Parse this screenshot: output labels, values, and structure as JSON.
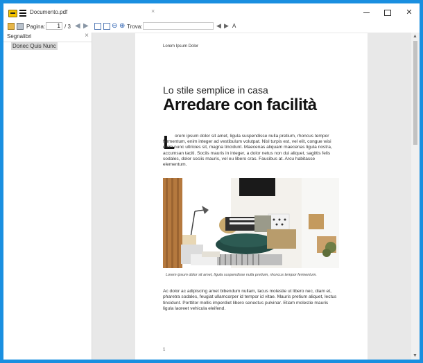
{
  "window": {
    "title": "Documento.pdf",
    "tab_close": "×",
    "minimize": "",
    "maximize": "",
    "close": "✕"
  },
  "toolbar": {
    "page_label": "Pagina:",
    "page_current": "1",
    "page_total": "/ 3",
    "find_label": "Trova:",
    "find_value": "",
    "case_icon": "A"
  },
  "bookmarks": {
    "title": "Segnalibri",
    "close": "×",
    "items": [
      {
        "label": "Donec Quis Nunc"
      }
    ]
  },
  "document": {
    "header": "Lorem Ipsum Dolor",
    "subtitle": "Lo stile semplice in casa",
    "title": "Arredare con facilità",
    "dropcap": "L",
    "body1": "orem ipsum dolor sit amet, ligula suspendisse nulla pretium, rhoncus tempor fermentum, enim integer ad vestibulum volutpat. Nisl turpis est, vel elit, congue wisi enim nunc ultricies sit, magna tincidunt. Maecenas aliquam maecenas ligula nostra, accumsan taciti. Sociis mauris in integer, a dolor netus non dui aliquet, sagittis felis sodales, dolor sociis mauris, vel eu libero cras. Faucibus at. Arcu habitasse elementum.",
    "caption": "Lorem ipsum dolor sit amet, ligula suspendisse nulla pretium, rhoncus tempor fermentum.",
    "body2": "Ac dolor ac adipiscing amet bibendum nullam, lacus molestie ut libero nec, diam et, pharetra sodales, feugiat ullamcorper id tempor id vitae. Mauris pretium aliquet, lectus tincidunt. Porttitor mollis imperdiet libero senectus pulvinar. Etiam molestie mauris ligula laoreet vehicula eleifend.",
    "page_number": "1"
  }
}
